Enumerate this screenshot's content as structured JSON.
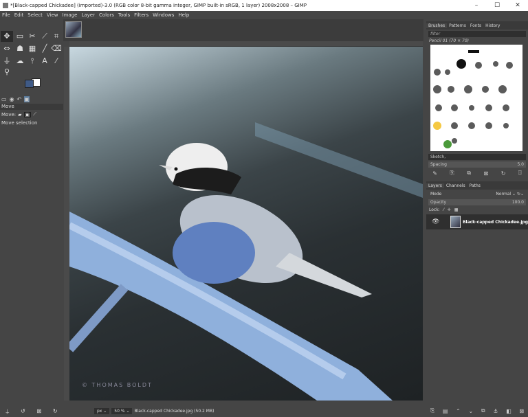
{
  "window": {
    "title": "*[Black-capped Chickadee] (imported)-3.0 (RGB color 8-bit gamma integer, GIMP built-in sRGB, 1 layer) 2008x2008 – GIMP",
    "minimize": "–",
    "maximize": "☐",
    "close": "✕"
  },
  "menu": [
    "File",
    "Edit",
    "Select",
    "View",
    "Image",
    "Layer",
    "Colors",
    "Tools",
    "Filters",
    "Windows",
    "Help"
  ],
  "toolbox": {
    "colors": {
      "fg": "#3f5a86",
      "bg": "#ffffff"
    },
    "options_title": "Move",
    "move_label": "Move:",
    "move_hint": "Move selection"
  },
  "canvas": {
    "watermark": "© THOMAS BOLDT"
  },
  "brushes": {
    "tabs": [
      "Brushes",
      "Patterns",
      "Fonts",
      "History"
    ],
    "filter_placeholder": "filter",
    "brush_name": "Pencil 01 (70 × 70)",
    "tag": "Sketch,",
    "spacing_label": "Spacing",
    "spacing_value": "5.0"
  },
  "layers": {
    "tabs": [
      "Layers",
      "Channels",
      "Paths"
    ],
    "mode_label": "Mode",
    "mode_value": "Normal",
    "opacity_label": "Opacity",
    "opacity_value": "100.0",
    "lock_label": "Lock:",
    "layer_name": "Black-capped Chickadee.jpg"
  },
  "status": {
    "unit": "px",
    "zoom": "50 %",
    "file": "Black-capped Chickadee.jpg (50.2 MB)"
  }
}
